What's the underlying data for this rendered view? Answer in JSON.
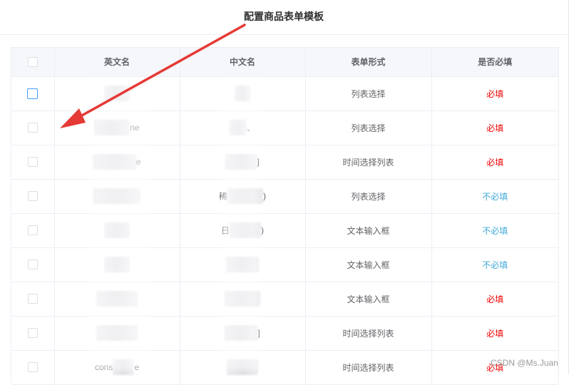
{
  "dialog": {
    "title": "配置商品表单模板"
  },
  "table": {
    "headers": [
      "英文名",
      "中文名",
      "表单形式",
      "是否必填"
    ],
    "rows": [
      {
        "en": "",
        "zh": "",
        "form": "列表选择",
        "required": "必填",
        "req": true
      },
      {
        "en": "ne",
        "zh": "、",
        "form": "列表选择",
        "required": "必填",
        "req": true
      },
      {
        "en": "e",
        "zh": "]",
        "form": "时间选择列表",
        "required": "必填",
        "req": true
      },
      {
        "en": "",
        "zh": "稀 )",
        "form": "列表选择",
        "required": "不必填",
        "req": false
      },
      {
        "en": "",
        "zh": "日 )",
        "form": "文本输入框",
        "required": "不必填",
        "req": false
      },
      {
        "en": "",
        "zh": "",
        "form": "文本输入框",
        "required": "不必填",
        "req": false
      },
      {
        "en": "",
        "zh": "",
        "form": "文本输入框",
        "required": "必填",
        "req": true
      },
      {
        "en": "",
        "zh": "]",
        "form": "时间选择列表",
        "required": "必填",
        "req": true
      },
      {
        "en": "cons e",
        "zh": "",
        "form": "时间选择列表",
        "required": "必填",
        "req": true
      }
    ]
  },
  "watermark": "CSDN @Ms.Juan",
  "colors": {
    "required": "#f00000",
    "not_required": "#40a9d8",
    "arrow": "#e53935"
  }
}
